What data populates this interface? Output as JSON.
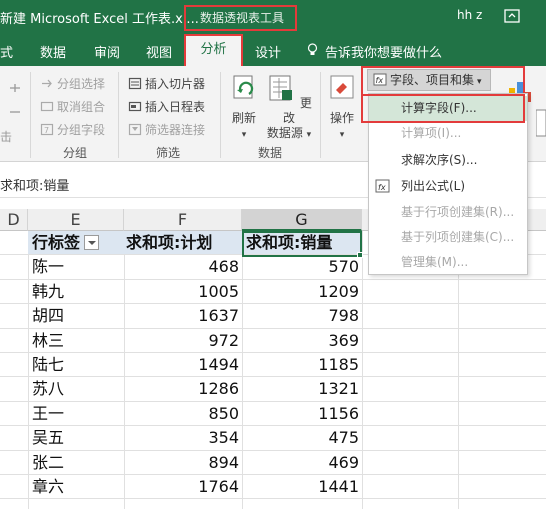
{
  "titlebar": {
    "doc_title": "新建 Microsoft Excel 工作表.xl...",
    "tool_title": "数据透视表工具",
    "user": "hh z"
  },
  "tabs": {
    "partial": "式",
    "data": "数据",
    "review": "审阅",
    "view": "视图",
    "analyze": "分析",
    "design": "设计",
    "tell_me": "告诉我你想要做什么"
  },
  "ribbon": {
    "group_select": "分组选择",
    "ungroup": "取消组合",
    "group_field": "分组字段",
    "group_label": "分组",
    "insert_slicer": "插入切片器",
    "insert_timeline": "插入日程表",
    "filter_connections": "筛选器连接",
    "filter_label": "筛选",
    "refresh": "刷新",
    "change_source_1": "更改",
    "change_source_2": "数据源",
    "data_label": "数据",
    "actions": "操作",
    "fields_items_sets": "字段、项目和集"
  },
  "menu": {
    "items": [
      {
        "label": "计算字段(F)...",
        "enabled": true
      },
      {
        "label": "计算项(I)...",
        "enabled": false
      },
      {
        "label": "求解次序(S)...",
        "enabled": true
      },
      {
        "label": "列出公式(L)",
        "enabled": true
      },
      {
        "label": "基于行项创建集(R)...",
        "enabled": false
      },
      {
        "label": "基于列项创建集(C)...",
        "enabled": false
      },
      {
        "label": "管理集(M)...",
        "enabled": false
      }
    ]
  },
  "formula_bar": {
    "content": "求和项:销量"
  },
  "columns": [
    "D",
    "E",
    "F",
    "G"
  ],
  "table": {
    "headers": [
      "行标签",
      "求和项:计划",
      "求和项:销量"
    ],
    "rows": [
      [
        "陈一",
        "468",
        "570"
      ],
      [
        "韩九",
        "1005",
        "1209"
      ],
      [
        "胡四",
        "1637",
        "798"
      ],
      [
        "林三",
        "972",
        "369"
      ],
      [
        "陆七",
        "1494",
        "1185"
      ],
      [
        "苏八",
        "1286",
        "1321"
      ],
      [
        "王一",
        "850",
        "1156"
      ],
      [
        "吴五",
        "354",
        "475"
      ],
      [
        "张二",
        "894",
        "469"
      ],
      [
        "章六",
        "1764",
        "1441"
      ]
    ]
  },
  "colors": {
    "excel_green": "#217346",
    "highlight_red": "#e33b3b",
    "header_fill": "#dce6f1"
  }
}
